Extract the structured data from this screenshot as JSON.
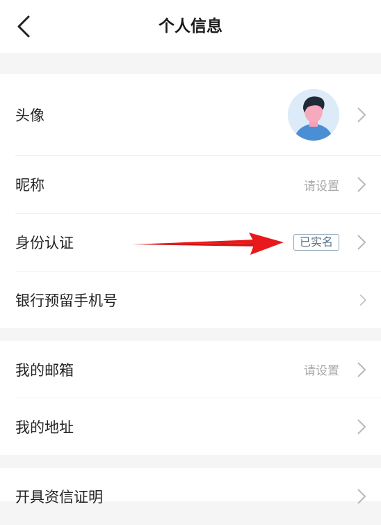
{
  "header": {
    "title": "个人信息",
    "back_icon": "chevron-left-icon"
  },
  "group1": {
    "avatar_row": {
      "label": "头像",
      "value_icon": "user-avatar"
    },
    "nickname_row": {
      "label": "昵称",
      "value": "请设置"
    },
    "identity_row": {
      "label": "身份认证",
      "badge": "已实名"
    },
    "bank_phone_row": {
      "label": "银行预留手机号"
    }
  },
  "group2": {
    "email_row": {
      "label": "我的邮箱",
      "value": "请设置"
    },
    "address_row": {
      "label": "我的地址"
    }
  },
  "group3": {
    "credit_row": {
      "label": "开具资信证明"
    }
  },
  "annotation": {
    "arrow_color": "#e8191c"
  },
  "colors": {
    "background": "#f5f5f5",
    "card": "#ffffff",
    "text": "#222222",
    "secondary_text": "#a8a8a8",
    "chevron": "#b8b8b8",
    "badge_border": "#8fa6b8"
  }
}
